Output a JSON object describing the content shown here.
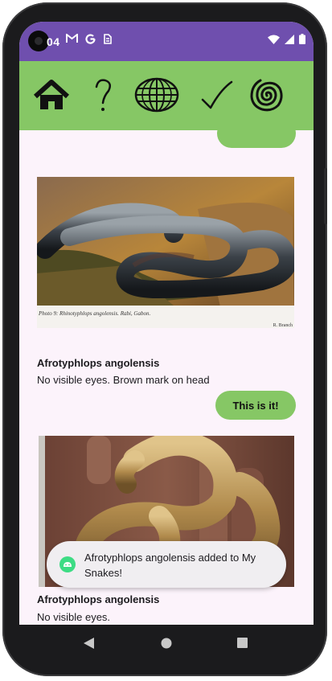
{
  "status_bar": {
    "time": "04",
    "icons": [
      "gmail-icon",
      "google-icon",
      "sim-icon"
    ]
  },
  "nav": [
    "home-icon",
    "question-icon",
    "globe-icon",
    "check-icon",
    "spiral-icon"
  ],
  "cards": [
    {
      "title": "Afrotyphlops angolensis",
      "description": "No visible eyes. Brown mark on head",
      "button": "This is it!",
      "image_caption_left": "Photo 9: Rhinotyphlops angolensis. Rabi, Gabon.",
      "image_caption_right": "R. Branch"
    },
    {
      "title": "Afrotyphlops angolensis",
      "description": "No visible eyes."
    }
  ],
  "toast": {
    "message": "Afrotyphlops angolensis added to My Snakes!"
  },
  "colors": {
    "status": "#6f4fae",
    "nav": "#86c765",
    "background": "#fcf3fb"
  }
}
